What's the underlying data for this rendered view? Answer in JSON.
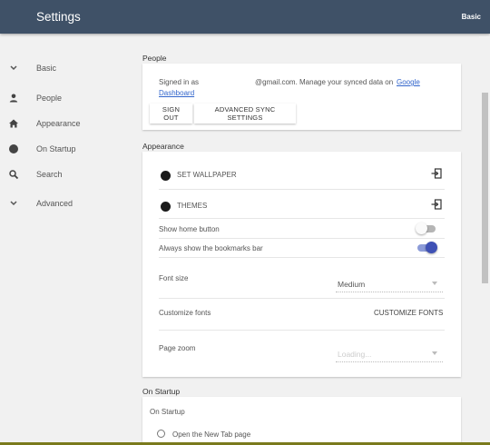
{
  "header": {
    "title": "Settings",
    "section_indicator": "Basic"
  },
  "sidebar": {
    "items": [
      {
        "label": "Basic",
        "icon": "chevron-down-icon"
      },
      {
        "label": "People",
        "icon": "person-icon"
      },
      {
        "label": "Appearance",
        "icon": "home-icon"
      },
      {
        "label": "On Startup",
        "icon": "circle-icon"
      },
      {
        "label": "Search",
        "icon": "search-icon"
      },
      {
        "label": "Advanced",
        "icon": "chevron-down-icon"
      }
    ]
  },
  "people": {
    "section_title": "People",
    "signed_in_prefix": "Signed in as",
    "signed_in_suffix": "@gmail.com. Manage your synced data on",
    "link_part1": "Google",
    "link_part2": "Dashboard",
    "sign_out_label": "SIGN OUT",
    "advanced_sync_label": "ADVANCED SYNC SETTINGS"
  },
  "appearance": {
    "section_title": "Appearance",
    "set_wallpaper_label": "SET WALLPAPER",
    "themes_label": "THEMES",
    "show_home_button_label": "Show home button",
    "show_home_button_on": false,
    "bookmarks_bar_label": "Always show the bookmarks bar",
    "bookmarks_bar_on": true,
    "font_size_label": "Font size",
    "font_size_value": "Medium",
    "customize_fonts_label": "Customize fonts",
    "customize_fonts_button": "CUSTOMIZE FONTS",
    "page_zoom_label": "Page zoom",
    "page_zoom_value": "Loading..."
  },
  "on_startup": {
    "section_title": "On Startup",
    "card_heading": "On Startup",
    "option_new_tab": "Open the New Tab page"
  },
  "colors": {
    "header_bg": "#3f5167",
    "toggle_on": "#3f51b5",
    "link": "#3366cc"
  }
}
